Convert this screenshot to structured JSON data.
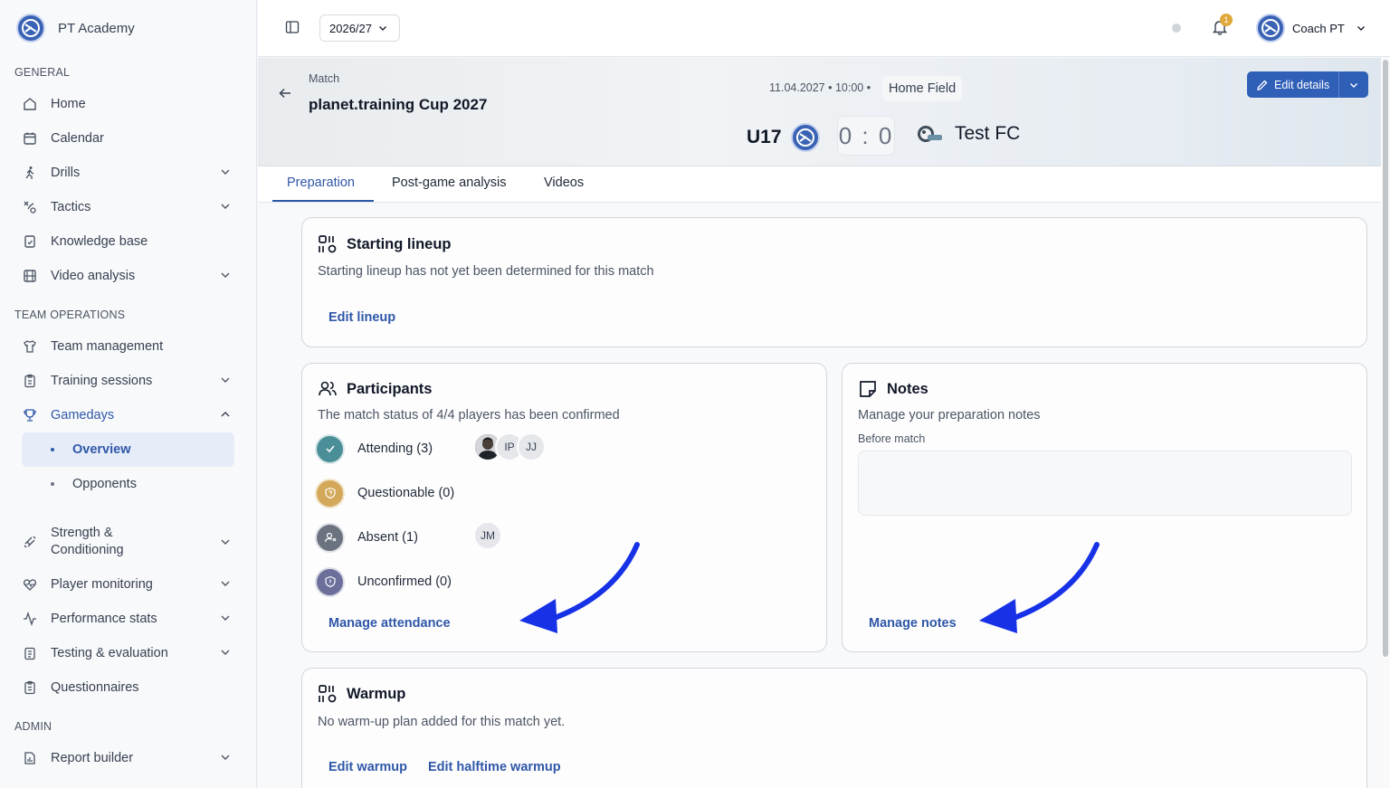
{
  "brand": {
    "name": "PT Academy"
  },
  "sidebar": {
    "sections": {
      "general": "GENERAL",
      "team_operations": "TEAM OPERATIONS",
      "admin": "ADMIN"
    },
    "items": {
      "home": "Home",
      "calendar": "Calendar",
      "drills": "Drills",
      "tactics": "Tactics",
      "knowledge_base": "Knowledge base",
      "video_analysis": "Video analysis",
      "team_management": "Team management",
      "training_sessions": "Training sessions",
      "gamedays": "Gamedays",
      "overview": "Overview",
      "opponents": "Opponents",
      "strength_line1": "Strength &",
      "strength_line2": "Conditioning",
      "player_monitoring": "Player monitoring",
      "performance_stats": "Performance stats",
      "testing_evaluation": "Testing & evaluation",
      "questionnaires": "Questionnaires",
      "report_builder": "Report builder"
    }
  },
  "topbar": {
    "season": "2026/27",
    "notification_count": "1",
    "user_name": "Coach PT"
  },
  "match": {
    "label": "Match",
    "title": "planet.training Cup 2027",
    "datetime": "11.04.2027 • 10:00 •",
    "venue": "Home Field",
    "home_team": "U17",
    "score": "0 : 0",
    "away_team": "Test FC",
    "edit_label": "Edit details"
  },
  "tabs": [
    "Preparation",
    "Post-game analysis",
    "Videos"
  ],
  "starting_lineup": {
    "title": "Starting lineup",
    "description": "Starting lineup has not yet been determined for this match",
    "link": "Edit lineup"
  },
  "participants": {
    "title": "Participants",
    "description": "The match status of 4/4 players has been confirmed",
    "statuses": {
      "attending": "Attending (3)",
      "questionable": "Questionable (0)",
      "absent": "Absent (1)",
      "unconfirmed": "Unconfirmed (0)"
    },
    "attending_avatars": [
      "IP",
      "JJ"
    ],
    "absent_avatars": [
      "JM"
    ],
    "link": "Manage attendance"
  },
  "notes": {
    "title": "Notes",
    "description": "Manage your preparation notes",
    "field_label": "Before match",
    "link": "Manage notes"
  },
  "warmup": {
    "title": "Warmup",
    "description": "No warm-up plan added for this match yet.",
    "link_warmup": "Edit warmup",
    "link_halftime": "Edit halftime warmup"
  },
  "colors": {
    "accent": "#2f57a8",
    "attending": "#4a8f97",
    "questionable": "#d4a85a",
    "absent": "#6b7280",
    "unconfirmed": "#6b6f9a",
    "annotation_arrow": "#1631e6"
  }
}
